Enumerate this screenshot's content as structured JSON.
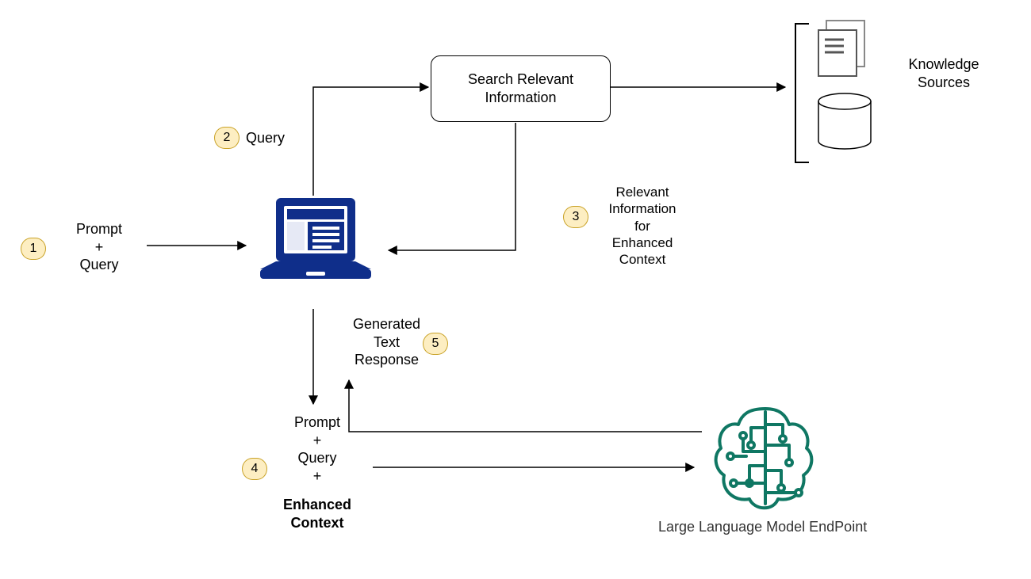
{
  "nodes": {
    "search_box": "Search Relevant\nInformation",
    "knowledge_sources_label": "Knowledge\nSources",
    "llm_label": "Large Language Model EndPoint"
  },
  "labels": {
    "step1": "Prompt\n+\nQuery",
    "step2": "Query",
    "step3": "Relevant\nInformation\nfor\nEnhanced\nContext",
    "step4_top": "Prompt\n+\nQuery\n+",
    "step4_bold": "Enhanced\nContext",
    "step5": "Generated\nText\nResponse"
  },
  "badges": {
    "b1": "1",
    "b2": "2",
    "b3": "3",
    "b4": "4",
    "b5": "5"
  },
  "icons": {
    "laptop": "laptop-icon",
    "documents": "documents-icon",
    "database": "database-icon",
    "brain": "brain-circuit-icon"
  },
  "colors": {
    "laptop": "#0f2e8a",
    "brain": "#0f7763",
    "badge_fill": "#fdeec2",
    "badge_stroke": "#c9a227"
  }
}
